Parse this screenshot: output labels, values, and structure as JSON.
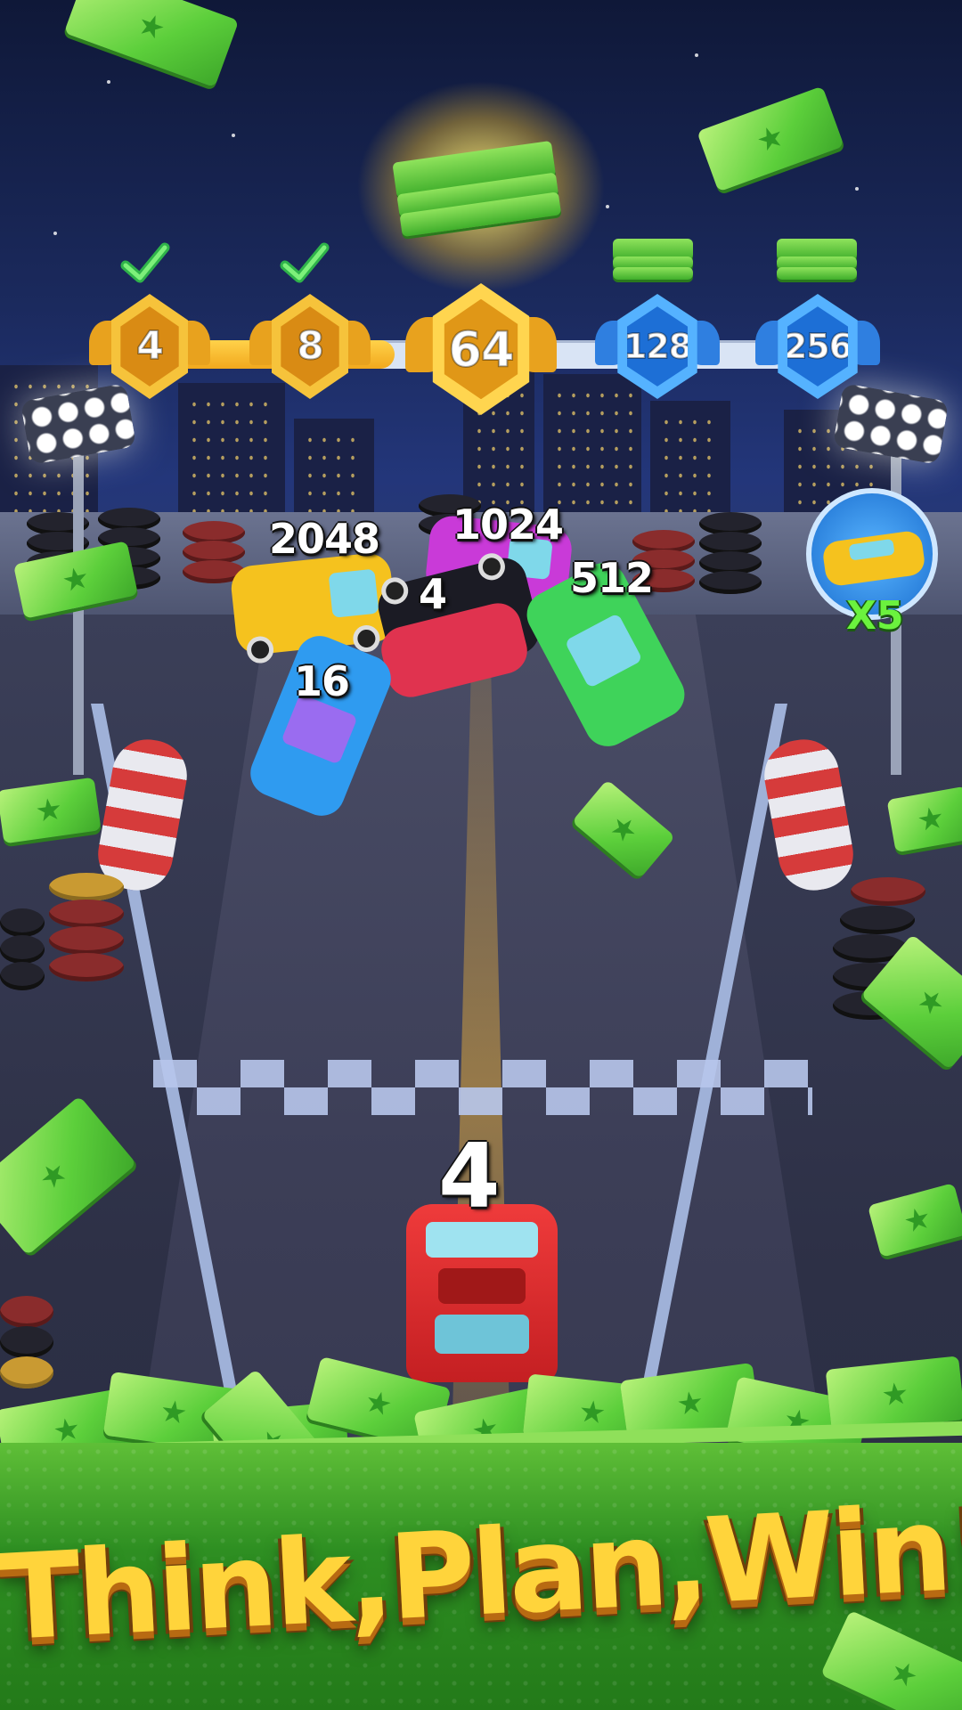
{
  "game": {
    "levels": [
      {
        "value": "4",
        "state": "completed",
        "reward": "check-icon"
      },
      {
        "value": "8",
        "state": "completed",
        "reward": "check-icon"
      },
      {
        "value": "64",
        "state": "current",
        "reward": "cash-stack-icon"
      },
      {
        "value": "128",
        "state": "locked",
        "reward": "cash-stack-icon"
      },
      {
        "value": "256",
        "state": "locked",
        "reward": "cash-stack-icon"
      }
    ],
    "cars": [
      {
        "label": "2048",
        "color": "#f5c21e"
      },
      {
        "label": "1024",
        "color": "#c93ad8"
      },
      {
        "label": "4",
        "color": "#1b1b24"
      },
      {
        "label": "512",
        "color": "#3fd35a"
      },
      {
        "label": "16",
        "color": "#2f9bf0"
      }
    ],
    "player_car": {
      "label": "4",
      "color": "#d8282a"
    },
    "reward_bubble": {
      "count": "X5",
      "icon": "yellow-car-icon"
    }
  },
  "banner": {
    "slogan": "Think,Plan,Win!"
  },
  "colors": {
    "gold": "#f2a81d",
    "blue": "#2b8ff0",
    "money": "#5ccf3b"
  }
}
